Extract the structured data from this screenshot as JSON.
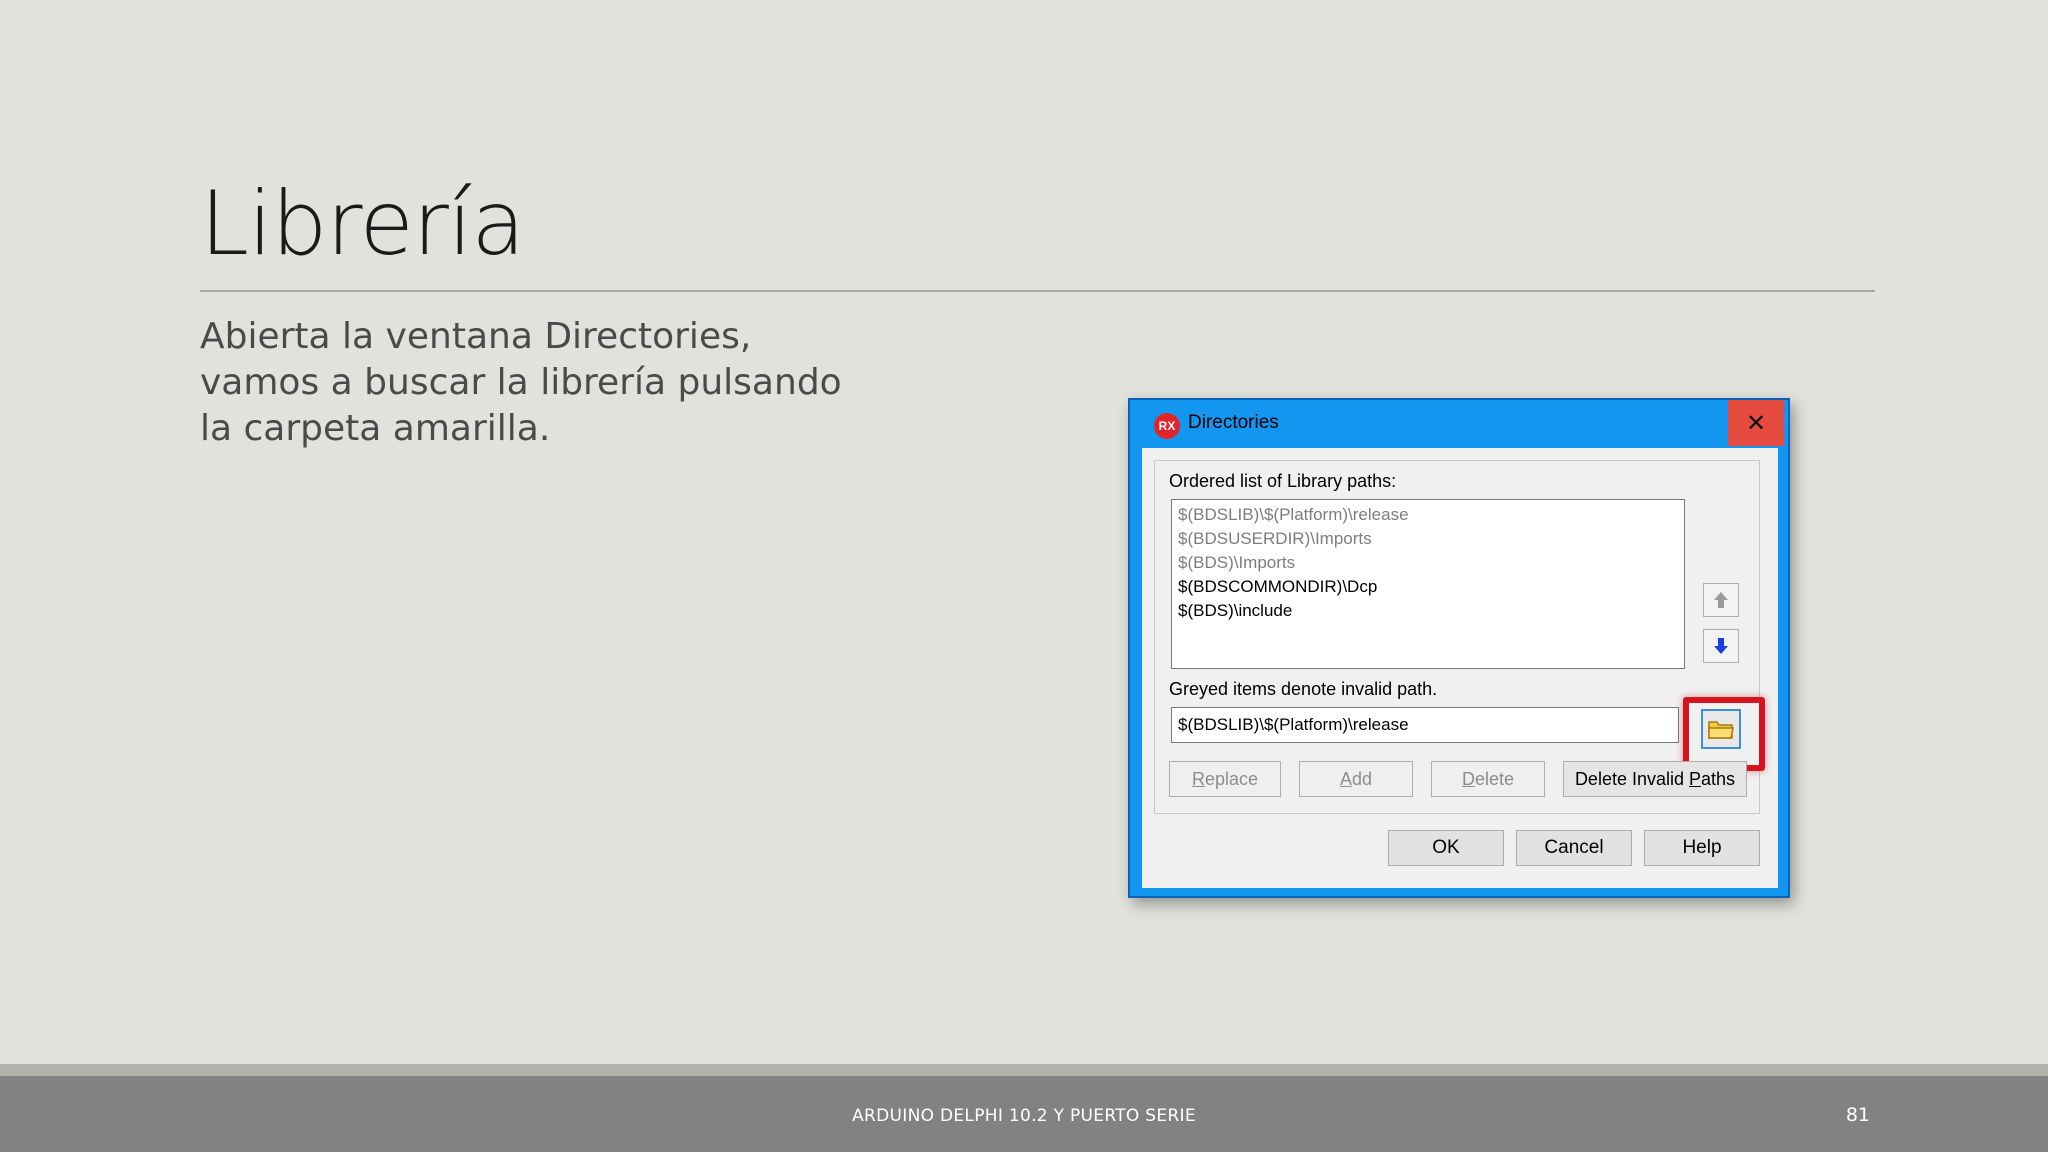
{
  "slide": {
    "title": "Librería",
    "body": "Abierta la ventana Directories, vamos a buscar la librería pulsando la carpeta amarilla.",
    "footer": "ARDUINO DELPHI 10.2 Y PUERTO SERIE",
    "page_number": "81"
  },
  "dialog": {
    "icon_text": "RX",
    "title": "Directories",
    "close_glyph": "✕",
    "list_label": "Ordered list of Library paths:",
    "paths": [
      {
        "text": "$(BDSLIB)\\$(Platform)\\release",
        "state": "invalid"
      },
      {
        "text": "$(BDSUSERDIR)\\Imports",
        "state": "invalid"
      },
      {
        "text": "$(BDS)\\Imports",
        "state": "invalid"
      },
      {
        "text": "$(BDSCOMMONDIR)\\Dcp",
        "state": "valid"
      },
      {
        "text": "$(BDS)\\include",
        "state": "valid"
      }
    ],
    "hint": "Greyed items denote invalid path.",
    "path_value": "$(BDSLIB)\\$(Platform)\\release",
    "buttons": {
      "replace_first": "R",
      "replace_rest": "eplace",
      "add_first": "A",
      "add_rest": "dd",
      "delete_first": "D",
      "delete_rest": "elete",
      "delete_invalid_pre": "Delete Invalid ",
      "delete_invalid_u": "P",
      "delete_invalid_post": "aths",
      "ok": "OK",
      "cancel": "Cancel",
      "help": "Help"
    },
    "icons": {
      "move_up": "arrow-up-icon",
      "move_down": "arrow-down-icon",
      "browse": "folder-icon"
    },
    "colors": {
      "frame": "#1296f0",
      "close": "#e54a3f",
      "highlight": "#d7141e",
      "folder": "#f5c842"
    }
  }
}
